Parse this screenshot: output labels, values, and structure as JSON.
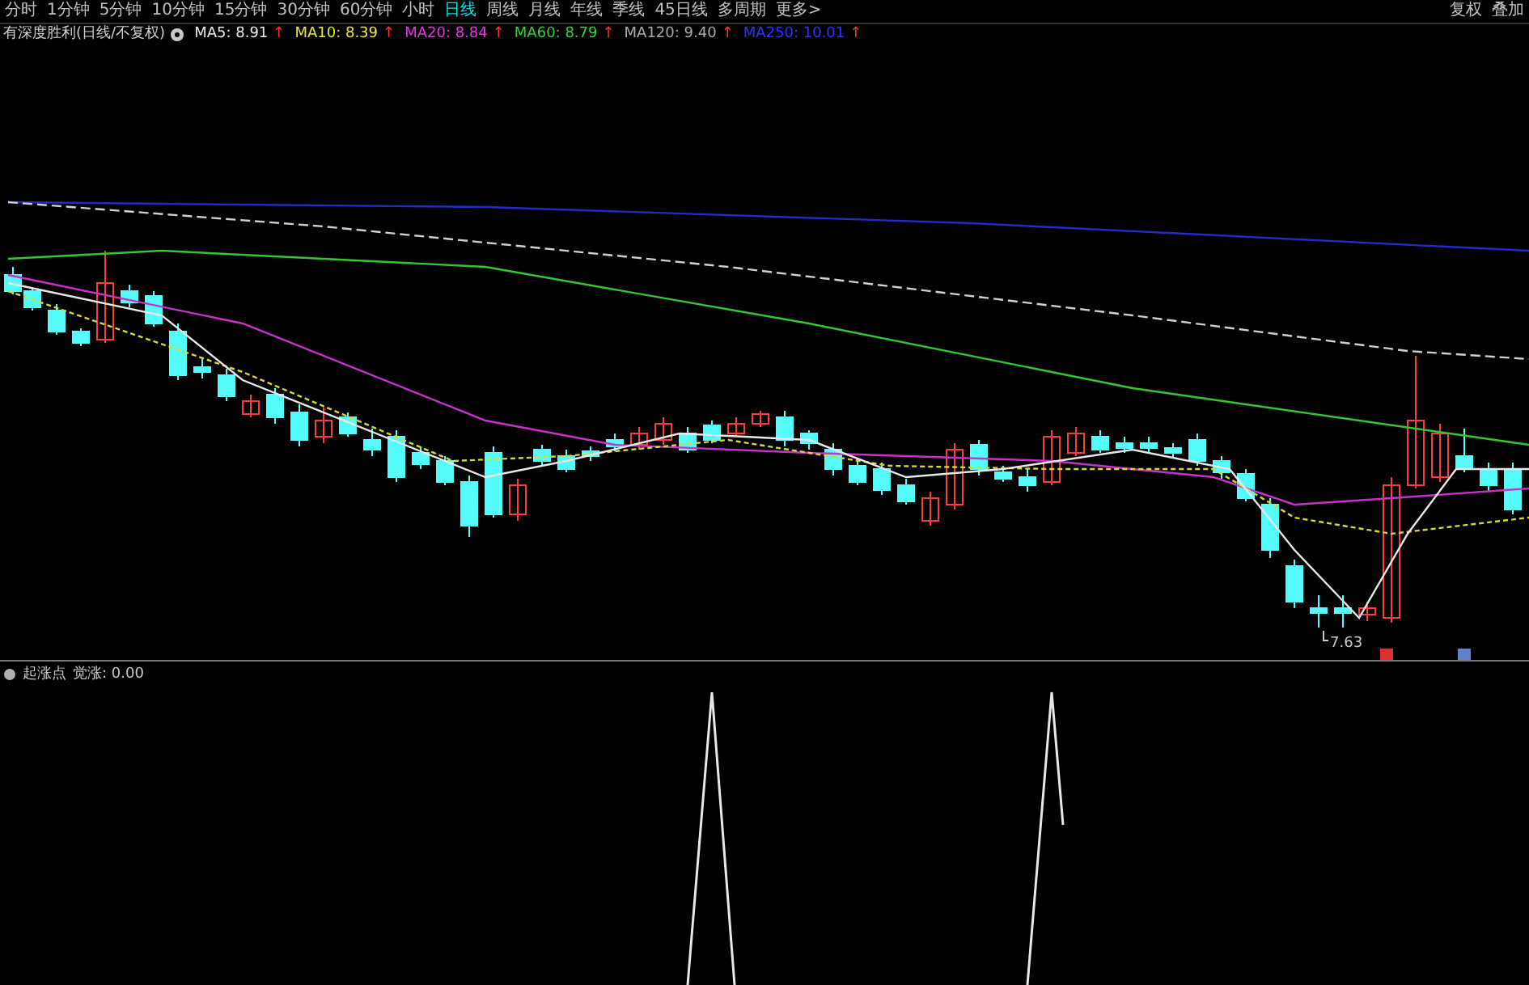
{
  "period_tabs": [
    {
      "label": "分时",
      "selected": false
    },
    {
      "label": "1分钟",
      "selected": false
    },
    {
      "label": "5分钟",
      "selected": false
    },
    {
      "label": "10分钟",
      "selected": false
    },
    {
      "label": "15分钟",
      "selected": false
    },
    {
      "label": "30分钟",
      "selected": false
    },
    {
      "label": "60分钟",
      "selected": false
    },
    {
      "label": "小时",
      "selected": false
    },
    {
      "label": "日线",
      "selected": true
    },
    {
      "label": "周线",
      "selected": false
    },
    {
      "label": "月线",
      "selected": false
    },
    {
      "label": "年线",
      "selected": false
    },
    {
      "label": "季线",
      "selected": false
    },
    {
      "label": "45日线",
      "selected": false
    },
    {
      "label": "多周期",
      "selected": false
    },
    {
      "label": "更多>",
      "selected": false
    }
  ],
  "toolbar_right": [
    "复权",
    "叠加"
  ],
  "price_chart": {
    "title": "有深度胜利(日线/不复权)",
    "ma_readings": [
      {
        "label": "MA5:",
        "value": "8.91",
        "arrow": "↑",
        "color": "#e8e8e8"
      },
      {
        "label": "MA10:",
        "value": "8.39",
        "arrow": "↑",
        "color": "#e8e832"
      },
      {
        "label": "MA20:",
        "value": "8.84",
        "arrow": "↑",
        "color": "#e832e8"
      },
      {
        "label": "MA60:",
        "value": "8.79",
        "arrow": "↑",
        "color": "#32d232"
      },
      {
        "label": "MA120:",
        "value": "9.40",
        "arrow": "↑",
        "color": "#a8a8a8"
      },
      {
        "label": "MA250:",
        "value": "10.01",
        "arrow": "↑",
        "color": "#3232ff"
      }
    ],
    "low_price_label": "7.63"
  },
  "indicator_panel": {
    "title": "起涨点",
    "reading": "觉涨: 0.00"
  }
}
